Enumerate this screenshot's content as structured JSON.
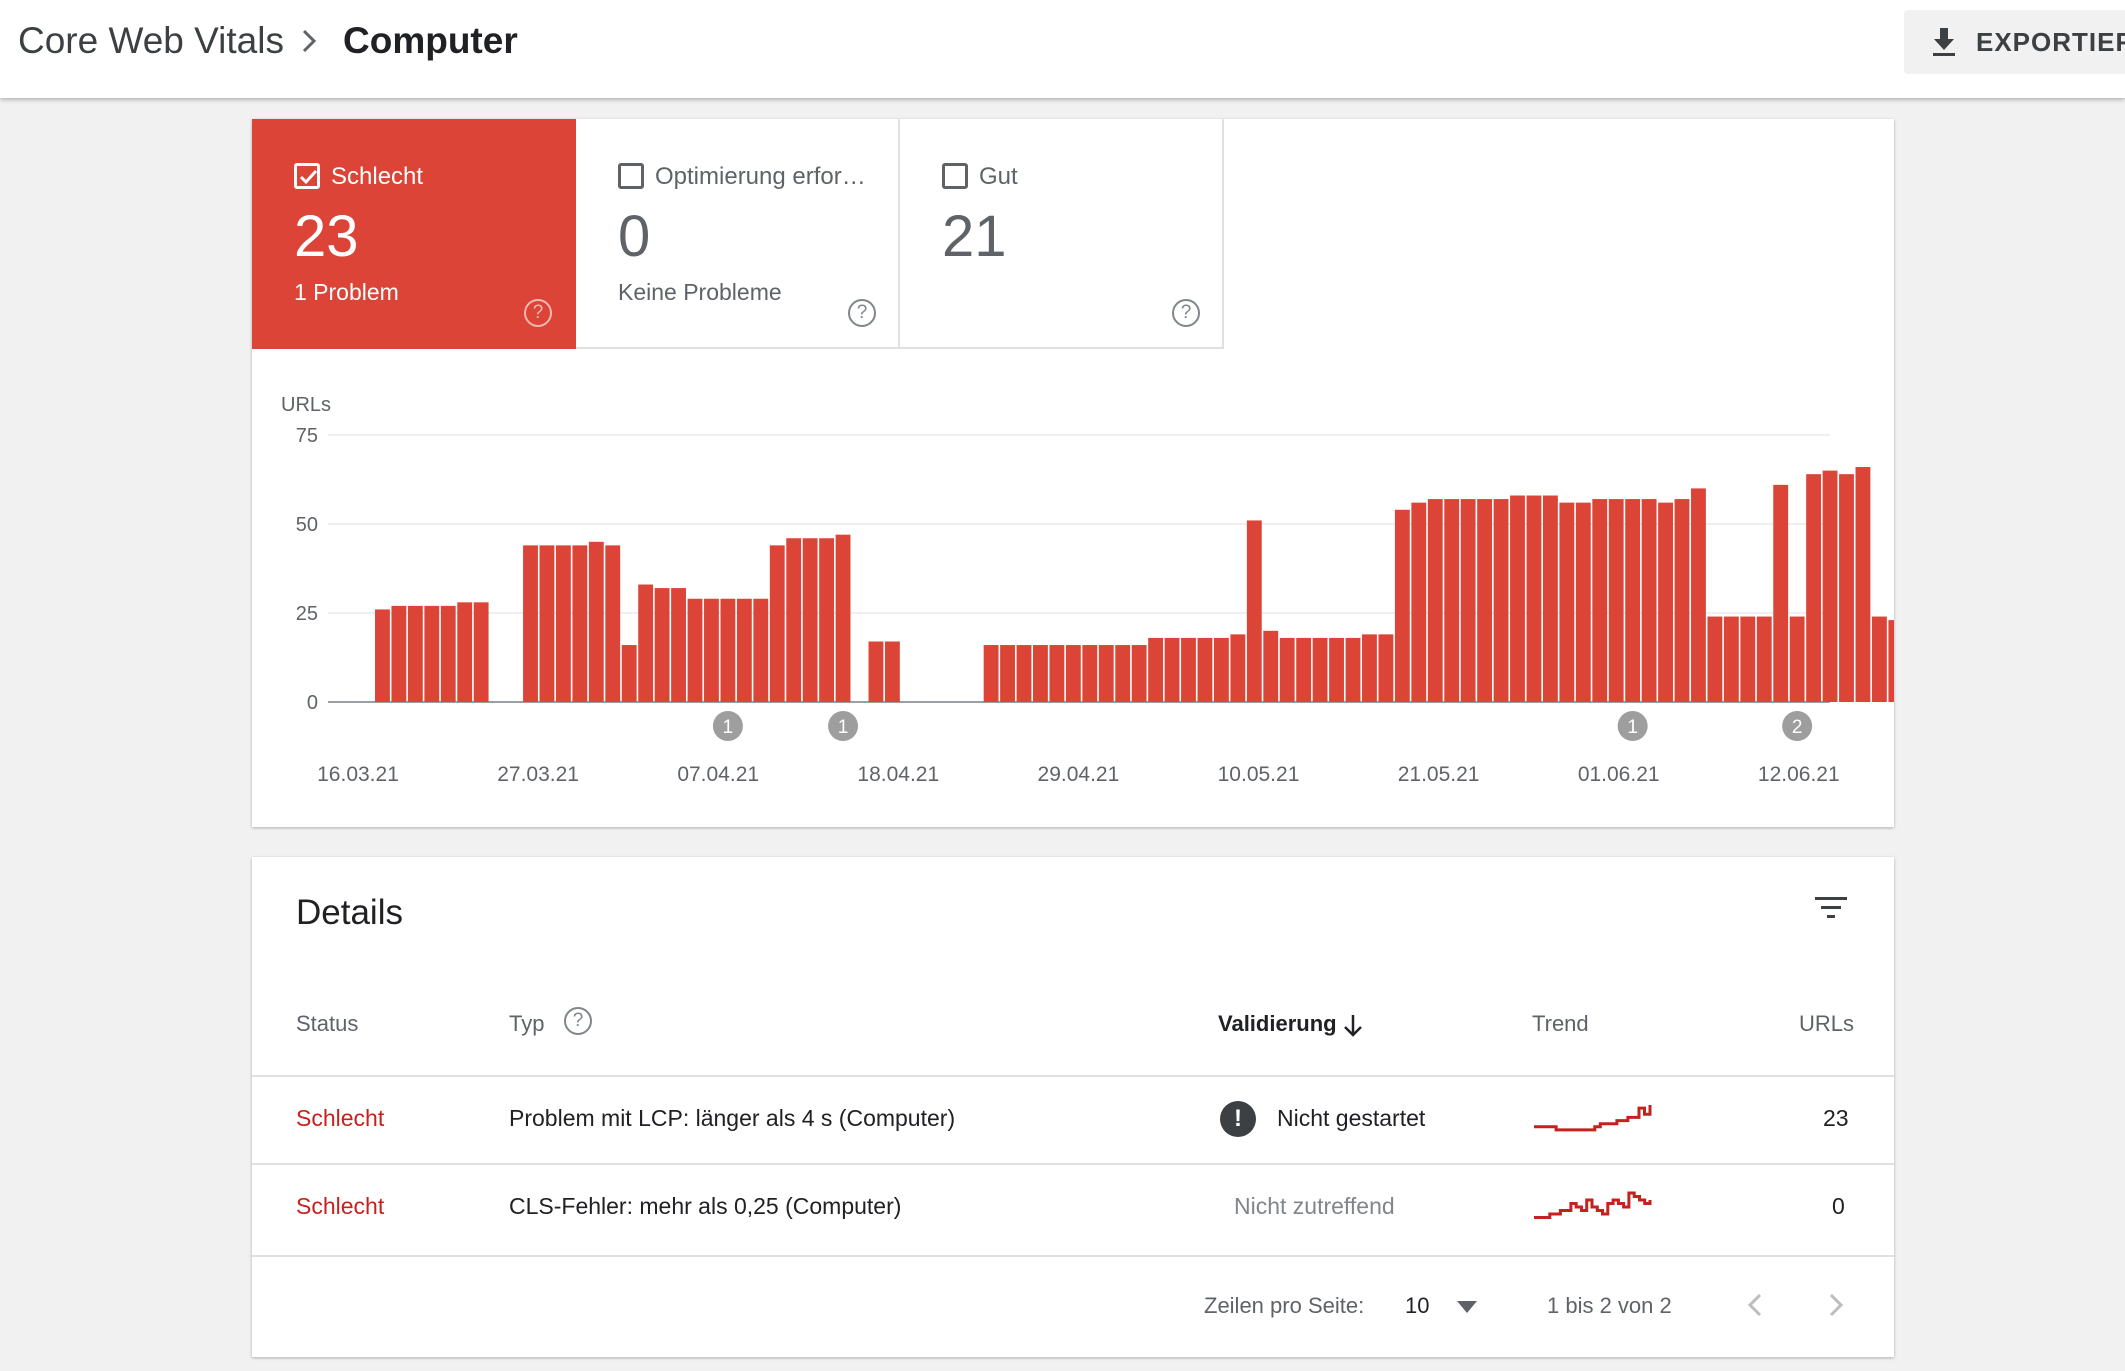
{
  "header": {
    "breadcrumb_root": "Core Web Vitals",
    "breadcrumb_current": "Computer",
    "export_label": "EXPORTIEREN"
  },
  "summary": {
    "tiles": [
      {
        "label": "Schlecht",
        "count": "23",
        "sub": "1 Problem",
        "checked": true
      },
      {
        "label": "Optimierung erfor…",
        "count": "0",
        "sub": "Keine Probleme",
        "checked": false
      },
      {
        "label": "Gut",
        "count": "21",
        "sub": "",
        "checked": false
      }
    ]
  },
  "chart_data": {
    "type": "bar",
    "ylabel": "URLs",
    "ylim": [
      0,
      75
    ],
    "yticks": [
      0,
      25,
      50,
      75
    ],
    "bar_color": "#db4437",
    "xtick_labels": [
      "16.03.21",
      "27.03.21",
      "07.04.21",
      "18.04.21",
      "29.04.21",
      "10.05.21",
      "21.05.21",
      "01.06.21",
      "12.06.21"
    ],
    "start_date": "16.03.21",
    "values": [
      null,
      26,
      27,
      27,
      27,
      27,
      28,
      28,
      null,
      null,
      44,
      44,
      44,
      44,
      45,
      44,
      16,
      33,
      32,
      32,
      29,
      29,
      29,
      29,
      29,
      44,
      46,
      46,
      46,
      47,
      null,
      17,
      17,
      null,
      null,
      null,
      null,
      null,
      16,
      16,
      16,
      16,
      16,
      16,
      16,
      16,
      16,
      16,
      18,
      18,
      18,
      18,
      18,
      19,
      51,
      20,
      18,
      18,
      18,
      18,
      18,
      19,
      19,
      54,
      56,
      57,
      57,
      57,
      57,
      57,
      58,
      58,
      58,
      56,
      56,
      57,
      57,
      57,
      57,
      56,
      57,
      60,
      24,
      24,
      24,
      24,
      61,
      24,
      64,
      65,
      64,
      66,
      24,
      23,
      23,
      23
    ],
    "annotations": [
      {
        "date": "07.04.21",
        "label": "1"
      },
      {
        "date": "14.04.21",
        "label": "1"
      },
      {
        "date": "01.06.21",
        "label": "1"
      },
      {
        "date": "11.06.21",
        "label": "2"
      }
    ]
  },
  "details": {
    "title": "Details",
    "columns": {
      "status": "Status",
      "type": "Typ",
      "validation": "Validierung",
      "trend": "Trend",
      "urls": "URLs"
    },
    "rows": [
      {
        "status": "Schlecht",
        "type": "Problem mit LCP: länger als 4 s (Computer)",
        "validation": "Nicht gestartet",
        "urls": "23",
        "trend": [
          2,
          2,
          2,
          2,
          1,
          1,
          1,
          1,
          1,
          1,
          1,
          2,
          3,
          3,
          3,
          4,
          4,
          5,
          5,
          8,
          6,
          9
        ]
      },
      {
        "status": "Schlecht",
        "type": "CLS-Fehler: mehr als 0,25 (Computer)",
        "validation": "Nicht zutreffend",
        "urls": "0",
        "trend": [
          1,
          1,
          1,
          2,
          2,
          3,
          3,
          5,
          4,
          3,
          6,
          4,
          3,
          2,
          5,
          6,
          5,
          4,
          8,
          7,
          6,
          5,
          6
        ]
      }
    ],
    "pagination": {
      "rows_per_page_label": "Zeilen pro Seite:",
      "rows_per_page": "10",
      "range": "1 bis 2 von 2"
    }
  }
}
